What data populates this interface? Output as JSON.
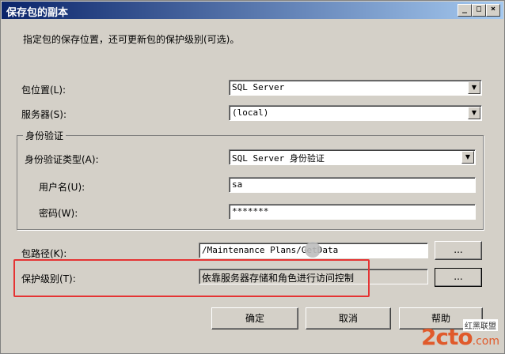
{
  "window": {
    "title": "保存包的副本"
  },
  "titlebar_buttons": {
    "minimize": "_",
    "maximize": "□",
    "close": "×"
  },
  "instruction": "指定包的保存位置，还可更新包的保护级别(可选)。",
  "package_location": {
    "label": "包位置(L):",
    "value": "SQL Server"
  },
  "server": {
    "label": "服务器(S):",
    "value": "(local)"
  },
  "authentication": {
    "group_title": "身份验证",
    "auth_type_label": "身份验证类型(A):",
    "auth_type_value": "SQL Server 身份验证",
    "username_label": "用户名(U):",
    "username_value": "sa",
    "password_label": "密码(W):",
    "password_value": "*******"
  },
  "package_path": {
    "label": "包路径(K):",
    "value": "/Maintenance Plans/GetData",
    "browse": "..."
  },
  "protection_level": {
    "label": "保护级别(T):",
    "value": "依靠服务器存储和角色进行访问控制",
    "browse": "..."
  },
  "buttons": {
    "ok": "确定",
    "cancel": "取消",
    "help": "帮助"
  },
  "watermark": {
    "logo": "2cto",
    "suffix": ".com",
    "tag": "红黑联盟"
  }
}
